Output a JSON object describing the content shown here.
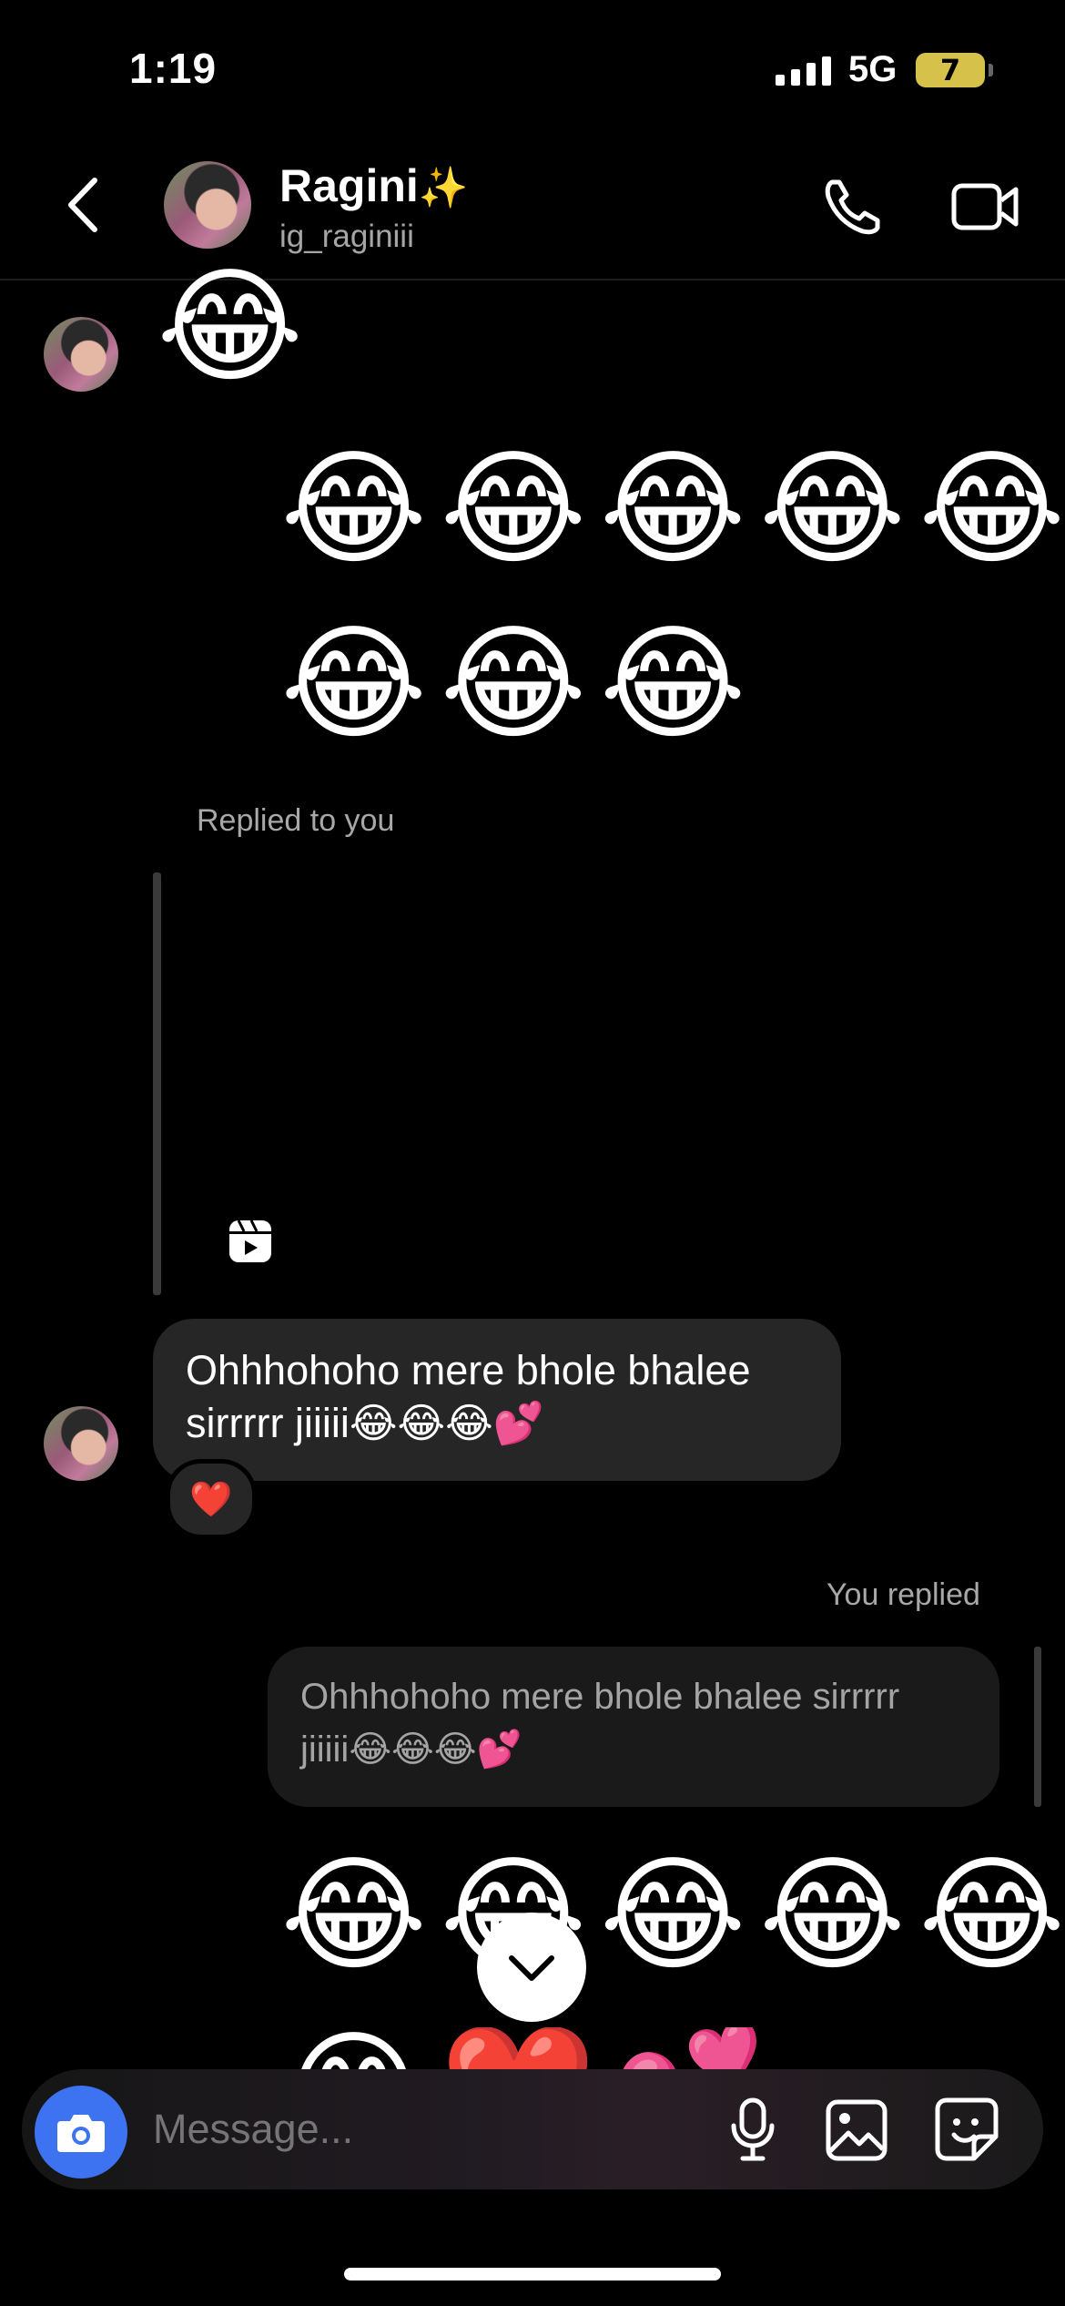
{
  "status_bar": {
    "time": "1:19",
    "network": "5G",
    "battery": "7"
  },
  "header": {
    "name": "Ragini",
    "name_emoji": "✨",
    "username": "ig_raginiii",
    "icons": [
      "back-icon",
      "phone-icon",
      "video-camera-icon"
    ]
  },
  "messages": {
    "top_emoji": "😂",
    "outgoing_row1": [
      "😂",
      "😂",
      "😂",
      "😂",
      "😂"
    ],
    "outgoing_row2": [
      "😂",
      "😂",
      "😂"
    ],
    "replied_label": "Replied to you",
    "incoming_text_line1": "Ohhhohoho mere bhole bhalee",
    "incoming_text_line2": "sirrrrr jiiiii😂😂😂💕",
    "reaction": "❤️",
    "you_replied_label": "You replied",
    "quoted_line1": "Ohhhohoho mere bhole bhalee sirrrrr",
    "quoted_line2": "jiiiii😂😂😂💕",
    "outgoing_row3": [
      "😂",
      "😂",
      "😂",
      "😂",
      "😂"
    ],
    "outgoing_row4": [
      "😂",
      "❤️",
      "💕"
    ]
  },
  "composer": {
    "placeholder": "Message...",
    "icons": [
      "camera-icon",
      "microphone-icon",
      "gallery-icon",
      "sticker-icon"
    ]
  },
  "colors": {
    "accent_blue": "#3d73f0",
    "bubble_incoming": "#262626",
    "reaction_red": "#ed1c4a"
  }
}
